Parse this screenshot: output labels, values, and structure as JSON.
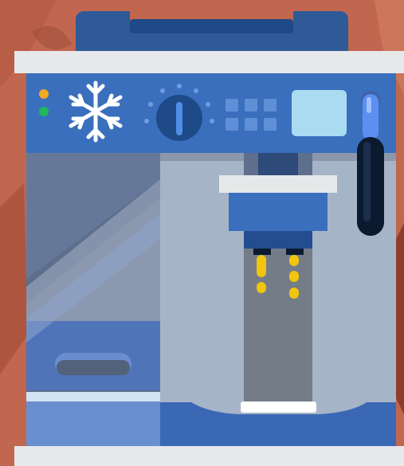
{
  "illustration": {
    "subject": "espresso-machine",
    "colors": {
      "background": "#c1664f",
      "background_dark": "#8e3c2a",
      "shelf": "#e7e8ea",
      "body_top": "#2e5a98",
      "panel": "#3a6fbd",
      "body_light": "#a6b4c7",
      "tank_glass": "#5d6f8c",
      "tank_water": "#6183c4",
      "drip_tray": "#3b68b5",
      "screen": "#a9dcf0",
      "indicator_orange": "#f2a81f",
      "indicator_green": "#1fb957",
      "coffee": "#f1c40f",
      "steam_wand": "#0c1a30"
    },
    "icons": [
      "snowflake-icon",
      "temperature-dial-icon"
    ],
    "coffee_streams": 2
  }
}
